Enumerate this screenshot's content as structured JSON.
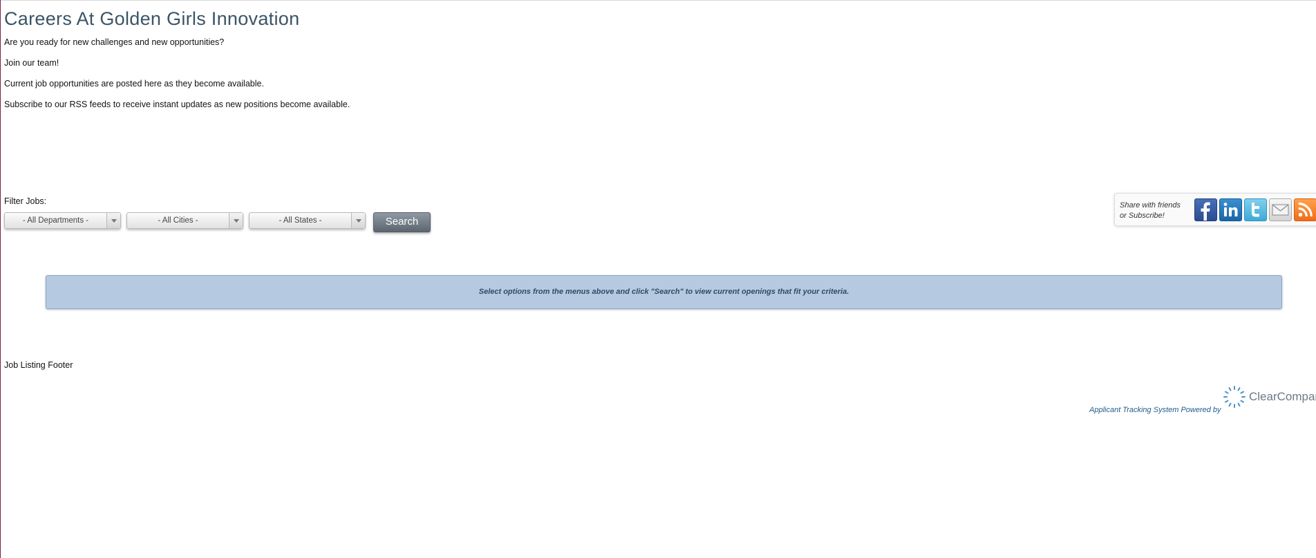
{
  "page": {
    "title": "Careers At Golden Girls Innovation",
    "intro": [
      "Are you ready for new challenges and new opportunities?",
      "Join our team!",
      "Current job opportunities are posted here as they become available.",
      "Subscribe to our RSS feeds to receive instant updates as new positions become available."
    ]
  },
  "filters": {
    "label": "Filter Jobs:",
    "department": "- All Departments -",
    "city": "- All Cities -",
    "state": "- All States -",
    "search_label": "Search"
  },
  "share": {
    "text_line1": "Share with friends",
    "text_line2": "or Subscribe!",
    "icons": [
      "facebook-icon",
      "linkedin-icon",
      "twitter-icon",
      "email-icon",
      "rss-icon"
    ]
  },
  "notice": {
    "text": "Select options from the menus above and click \"Search\" to view current openings that fit your criteria."
  },
  "footer": {
    "text": "Job Listing Footer",
    "powered_by": "Applicant Tracking System Powered by",
    "logo_text": "ClearCompany"
  },
  "colors": {
    "title": "#3b5466",
    "notice_bg": "#b5cae0",
    "notice_text": "#2f4a66",
    "powered_text": "#1e5a8c"
  }
}
